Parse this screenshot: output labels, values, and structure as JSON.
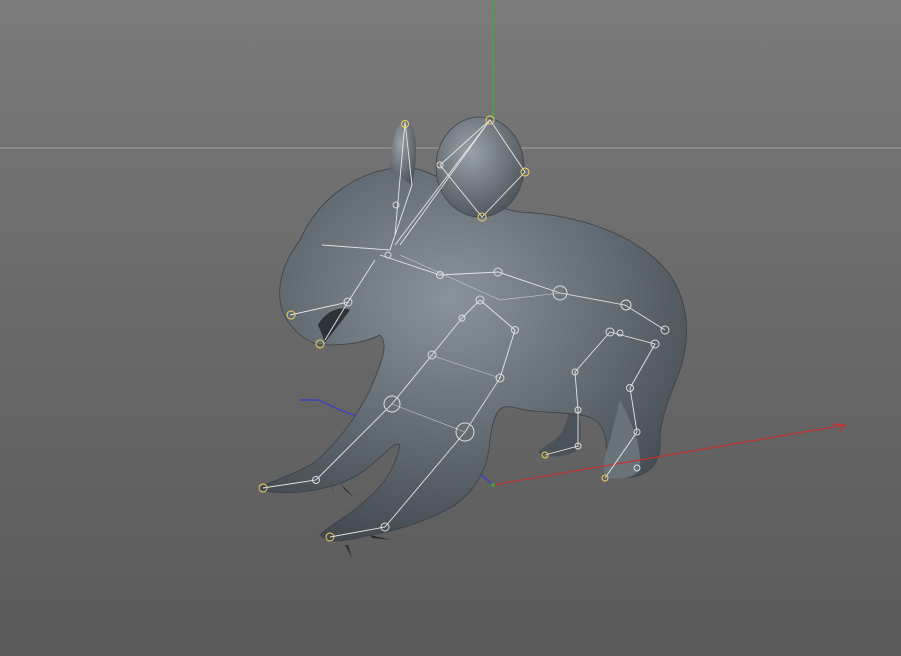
{
  "viewport": {
    "name": "3d-perspective-viewport",
    "background_color": "#6f6f6f"
  },
  "axes": {
    "x_color": "#c23232",
    "y_color": "#32b432",
    "z_color": "#3232c8"
  },
  "model": {
    "name": "koala-mesh",
    "body_color": "#5b636b",
    "highlight_color": "#8a939b"
  },
  "rig": {
    "bone_color": "#e6e6e6",
    "joint_color": "#f2d25a",
    "joint_outline": "#dcdcdc"
  }
}
